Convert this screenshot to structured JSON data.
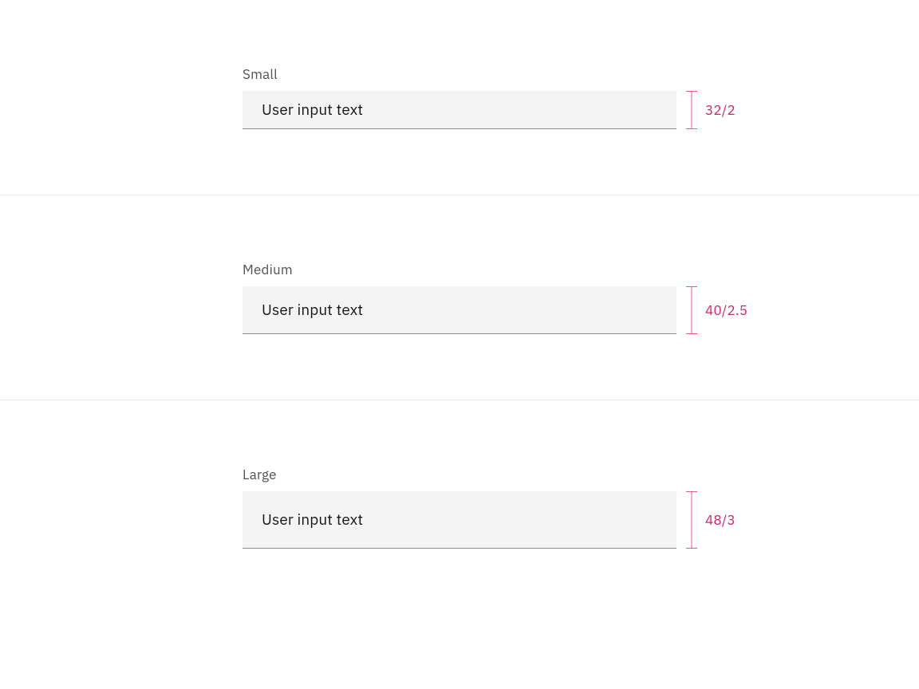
{
  "sizes": [
    {
      "label": "Small",
      "value": "User input text",
      "measure": "32/2"
    },
    {
      "label": "Medium",
      "value": "User input text",
      "measure": "40/2.5"
    },
    {
      "label": "Large",
      "value": "User input text",
      "measure": "48/3"
    }
  ],
  "colors": {
    "measure": "#d02670",
    "bracket": "#ee5396",
    "field_bg": "#f4f4f4",
    "border": "#8d8d8d"
  }
}
